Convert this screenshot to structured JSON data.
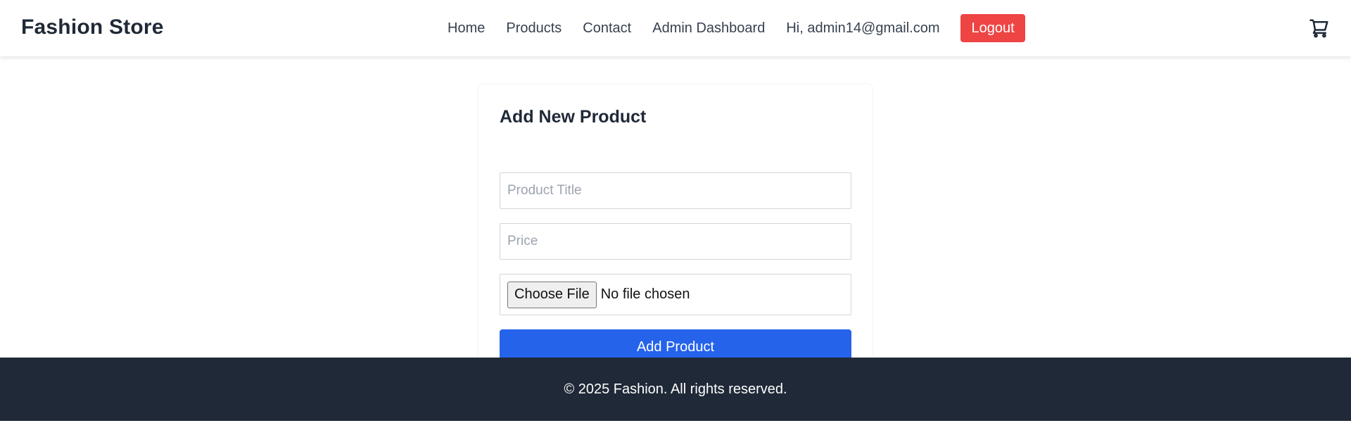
{
  "header": {
    "brand": "Fashion Store",
    "nav": {
      "home": "Home",
      "products": "Products",
      "contact": "Contact",
      "admin_dashboard": "Admin Dashboard"
    },
    "greeting": "Hi, admin14@gmail.com",
    "logout_label": "Logout",
    "cart_icon": "cart-icon"
  },
  "form": {
    "title": "Add New Product",
    "product_title": {
      "value": "",
      "placeholder": "Product Title"
    },
    "price": {
      "value": "",
      "placeholder": "Price"
    },
    "file_button_label": "Choose File",
    "file_status": "No file chosen",
    "submit_label": "Add Product"
  },
  "footer": {
    "copyright": "© 2025 Fashion. All rights reserved."
  },
  "colors": {
    "logout_bg": "#ef4444",
    "primary_button": "#2563eb",
    "footer_bg": "#1f2937",
    "text_dark": "#1f2937"
  }
}
